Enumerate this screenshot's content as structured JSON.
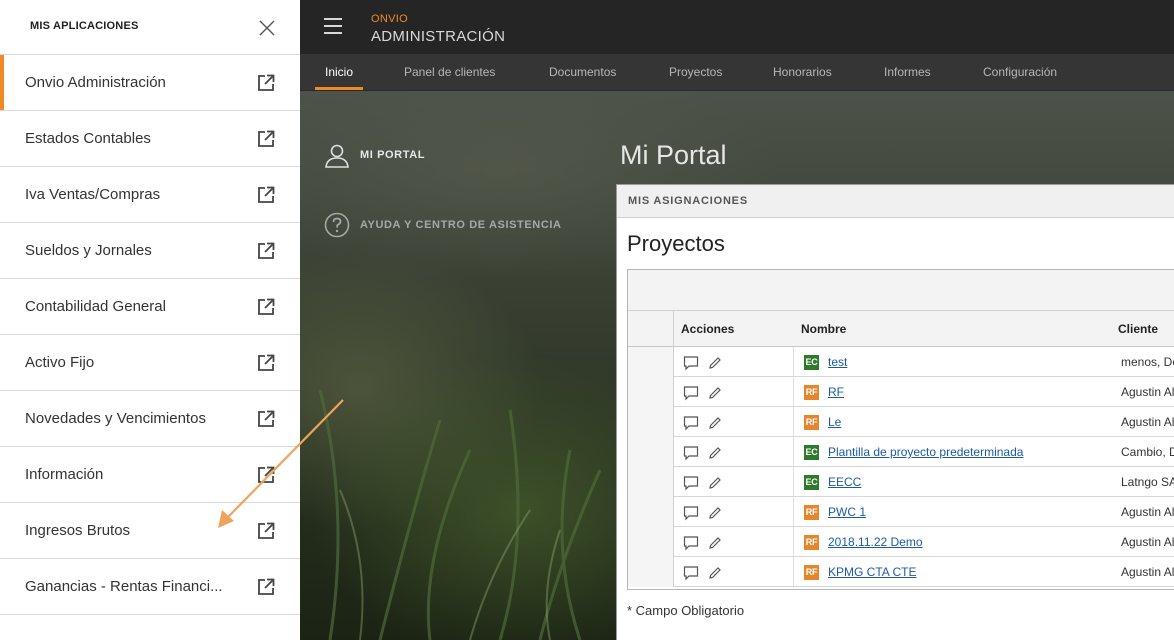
{
  "header": {
    "brand": "ONVIO",
    "title": "ADMINISTRACIÓN"
  },
  "nav": {
    "tabs": [
      {
        "label": "Inicio",
        "active": true
      },
      {
        "label": "Panel de clientes"
      },
      {
        "label": "Documentos"
      },
      {
        "label": "Proyectos"
      },
      {
        "label": "Honorarios"
      },
      {
        "label": "Informes"
      },
      {
        "label": "Configuración"
      }
    ]
  },
  "portal": {
    "links": [
      {
        "label": "MI PORTAL",
        "icon": "user-icon"
      },
      {
        "label": "AYUDA Y CENTRO DE ASISTENCIA",
        "icon": "help-icon"
      }
    ],
    "title": "Mi Portal"
  },
  "assignments": {
    "header": "MIS ASIGNACIONES",
    "subtitle": "Proyectos",
    "columns": {
      "actions": "Acciones",
      "name": "Nombre",
      "client": "Cliente"
    },
    "rows": [
      {
        "badge": "EC",
        "name": "test",
        "client": "menos, De"
      },
      {
        "badge": "RF",
        "name": "RF",
        "client": "Agustin Al"
      },
      {
        "badge": "RF",
        "name": "Le",
        "client": "Agustin Al"
      },
      {
        "badge": "EC",
        "name": "Plantilla de proyecto predeterminada",
        "client": "Cambio, D"
      },
      {
        "badge": "EC",
        "name": "EECC",
        "client": "Latngo SA"
      },
      {
        "badge": "RF",
        "name": "PWC 1",
        "client": "Agustin Al"
      },
      {
        "badge": "RF",
        "name": "2018.11.22 Demo",
        "client": "Agustin Al"
      },
      {
        "badge": "RF",
        "name": "KPMG CTA CTE",
        "client": "Agustin Al"
      }
    ],
    "required_note": "* Campo Obligatorio"
  },
  "drawer": {
    "title": "MIS APLICACIONES",
    "items": [
      {
        "label": "Onvio Administración",
        "active": true
      },
      {
        "label": "Estados Contables"
      },
      {
        "label": "Iva Ventas/Compras"
      },
      {
        "label": "Sueldos y Jornales"
      },
      {
        "label": "Contabilidad General"
      },
      {
        "label": "Activo Fijo"
      },
      {
        "label": "Novedades y Vencimientos"
      },
      {
        "label": "Información"
      },
      {
        "label": "Ingresos Brutos"
      },
      {
        "label": "Ganancias - Rentas Financi..."
      }
    ]
  },
  "colors": {
    "accent": "#f08a24",
    "badge_ec": "#2d7a2d",
    "badge_rf": "#e5852c",
    "link": "#1c5aa6"
  }
}
